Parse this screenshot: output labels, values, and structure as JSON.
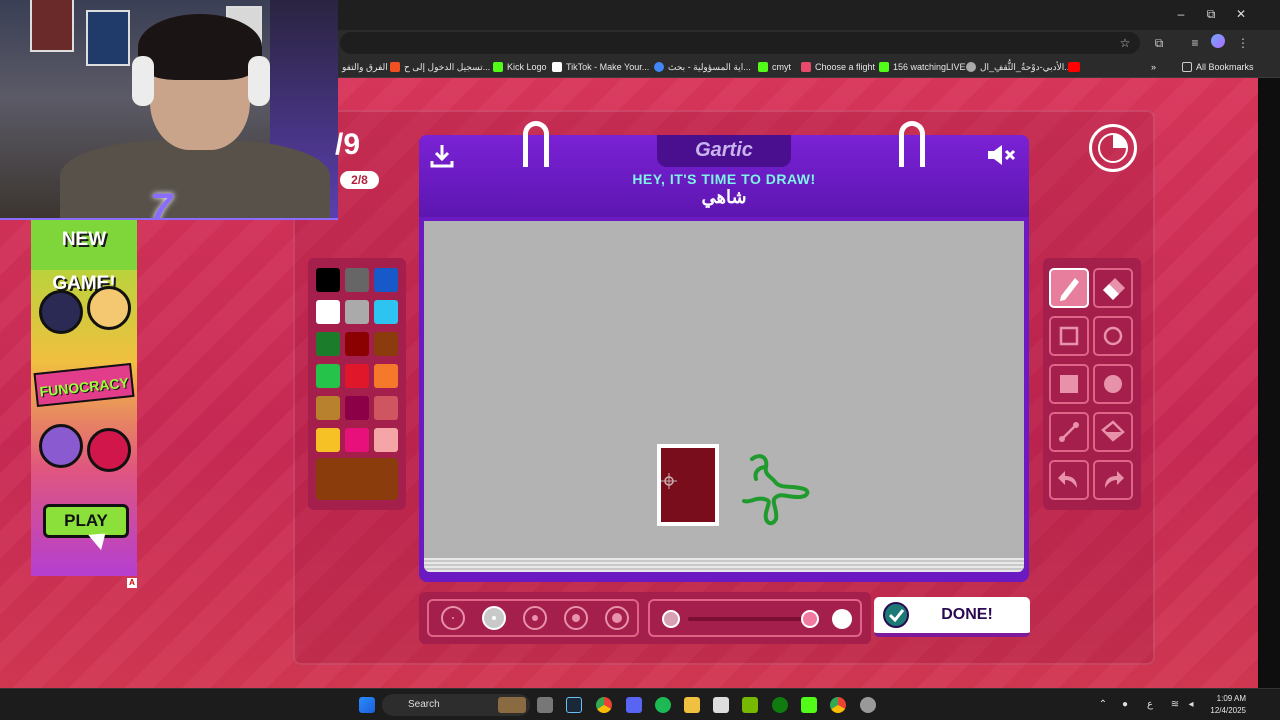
{
  "browser": {
    "window_controls": {
      "minimize": "–",
      "maximize": "⧉",
      "close": "✕"
    },
    "bookmarks": [
      {
        "label": "الفرق والتفو",
        "icon": "text",
        "color": "#888888"
      },
      {
        "label": "تسجيل الدخول إلى ح...",
        "icon": "microsoft-icon",
        "color": "#f25022"
      },
      {
        "label": "Kick Logo",
        "icon": "kick-icon",
        "color": "#53fc18"
      },
      {
        "label": "TikTok - Make Your...",
        "icon": "tiktok-icon",
        "color": "#ffffff"
      },
      {
        "label": "اية المسؤولية - بحث...",
        "icon": "google-icon",
        "color": "#4285f4"
      },
      {
        "label": "cmyt",
        "icon": "kick-icon",
        "color": "#53fc18"
      },
      {
        "label": "Choose a flight",
        "icon": "plane-icon",
        "color": "#e84a6b"
      },
      {
        "label": "156 watchingLIVE",
        "icon": "kick-icon",
        "color": "#53fc18"
      },
      {
        "label": "الأدبي-دوْحةُ_الثُّقفِ_ال...",
        "icon": "globe-icon",
        "color": "#aaaaaa"
      },
      {
        "label": "",
        "icon": "youtube-icon",
        "color": "#ff0000"
      }
    ],
    "bookmarks_overflow": "»",
    "all_bookmarks": "All Bookmarks"
  },
  "ad": {
    "headline": "NEW GAME!",
    "brand": "FUNOCRACY",
    "cta": "PLAY",
    "badge": "A"
  },
  "game": {
    "round_main": "/9",
    "round_sub": "2/8",
    "title": "Gartic",
    "prompt": "HEY, IT'S TIME TO DRAW!",
    "word": "شاهي",
    "done_label": "DONE!",
    "timer_elapsed_fraction": 0.25,
    "palette": [
      "#000000",
      "#666666",
      "#1759c8",
      "#ffffff",
      "#aaaaaa",
      "#2ec4f1",
      "#1b7d2c",
      "#8b0000",
      "#8b3c0d",
      "#26c34a",
      "#e0162b",
      "#f5782b",
      "#b8812e",
      "#8b0047",
      "#cf5660",
      "#f5c125",
      "#e8117b",
      "#f5a5a5"
    ],
    "current_color": "#8b3c0d",
    "brush_sizes": 5,
    "brush_size_selected_index": 1,
    "opacity_level_fraction": 1.0
  },
  "taskbar": {
    "search_label": "Search",
    "time": "1:09 AM",
    "date": "12/4/2025",
    "lang": "ع"
  }
}
